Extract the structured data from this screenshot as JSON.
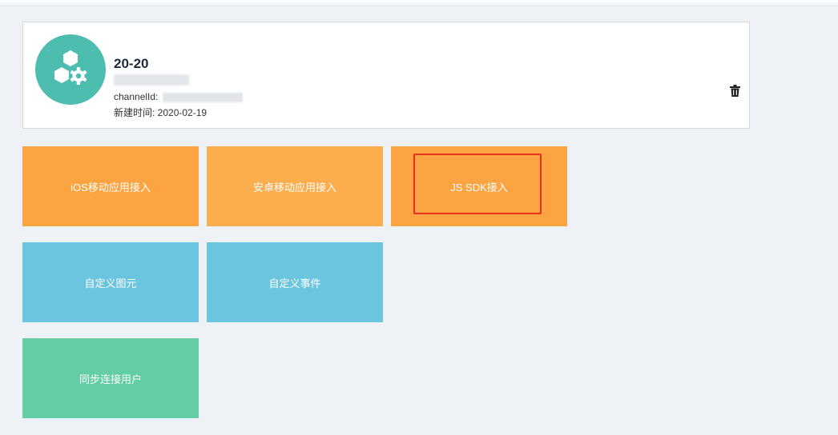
{
  "app_card": {
    "title": "20-20",
    "channel_label": "channelId: ",
    "created_label": "新建时间: 2020-02-19"
  },
  "tiles": [
    {
      "label": "iOS移动应用接入"
    },
    {
      "label": "安卓移动应用接入"
    },
    {
      "label": "JS SDK接入"
    },
    {
      "label": "自定义图元"
    },
    {
      "label": "自定义事件"
    },
    {
      "label": "同步连接用户"
    }
  ],
  "colors": {
    "avatar": "#4dbdb0",
    "tile_orange": "#fba441",
    "tile_blue": "#6cc5de",
    "tile_green": "#63cda3",
    "highlight": "#e8301f"
  },
  "icons": {
    "avatar": "hexagon-gear-icon",
    "delete": "trash-icon"
  }
}
